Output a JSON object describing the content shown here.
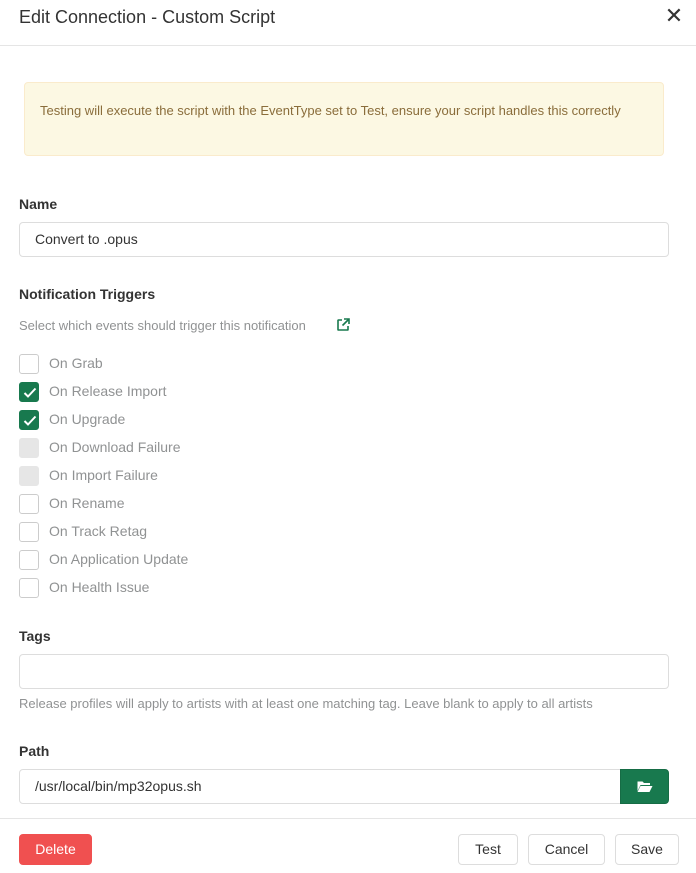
{
  "modal": {
    "title": "Edit Connection - Custom Script",
    "close_glyph": "✕",
    "alert": "Testing will execute the script with the EventType set to Test, ensure your script handles this correctly"
  },
  "name": {
    "label": "Name",
    "value": "Convert to .opus"
  },
  "triggers": {
    "label": "Notification Triggers",
    "help": "Select which events should trigger this notification",
    "link_icon": "external-link-icon",
    "items": [
      {
        "label": "On Grab",
        "state": "unchecked"
      },
      {
        "label": "On Release Import",
        "state": "checked"
      },
      {
        "label": "On Upgrade",
        "state": "checked"
      },
      {
        "label": "On Download Failure",
        "state": "disabled"
      },
      {
        "label": "On Import Failure",
        "state": "disabled"
      },
      {
        "label": "On Rename",
        "state": "unchecked"
      },
      {
        "label": "On Track Retag",
        "state": "unchecked"
      },
      {
        "label": "On Application Update",
        "state": "unchecked"
      },
      {
        "label": "On Health Issue",
        "state": "unchecked"
      }
    ]
  },
  "tags": {
    "label": "Tags",
    "value": "",
    "help": "Release profiles will apply to artists with at least one matching tag. Leave blank to apply to all artists"
  },
  "path": {
    "label": "Path",
    "value": "/usr/local/bin/mp32opus.sh",
    "button_icon": "folder-open-icon"
  },
  "footer": {
    "delete": "Delete",
    "test": "Test",
    "cancel": "Cancel",
    "save": "Save"
  },
  "colors": {
    "accent": "#18794e",
    "danger": "#f05050",
    "warning_bg": "#fcf8e3",
    "warning_text": "#8a6d3b"
  }
}
